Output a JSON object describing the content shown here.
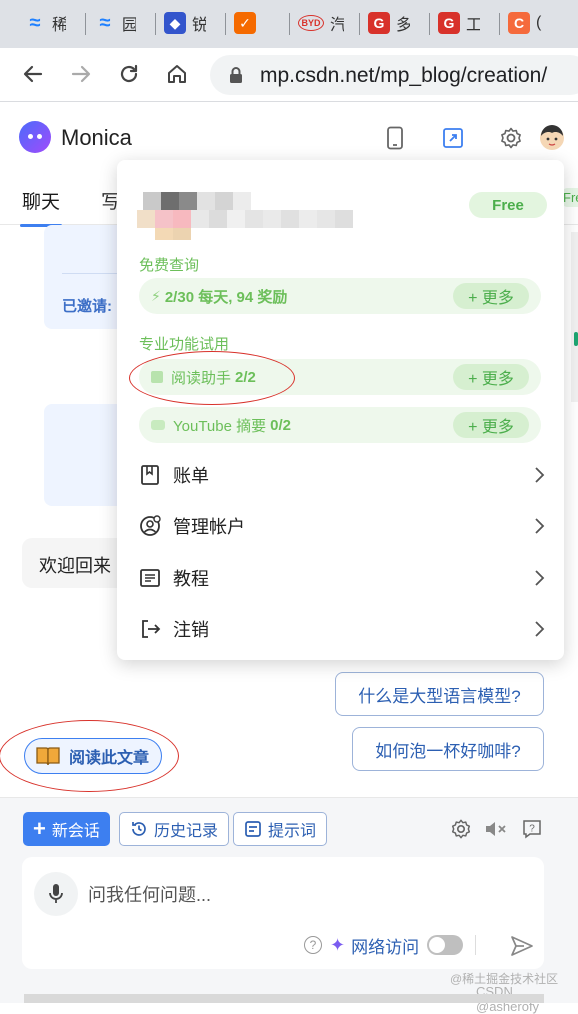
{
  "browser": {
    "tabs": [
      {
        "glyph": "≈",
        "label": "稀",
        "bg": "#ffffff",
        "fg": "#1e80ff"
      },
      {
        "glyph": "≈",
        "label": "园",
        "bg": "#ffffff",
        "fg": "#1e80ff"
      },
      {
        "glyph": "◆",
        "label": "锐",
        "bg": "#3355cc",
        "fg": "#ffffff"
      },
      {
        "glyph": "✓",
        "label": "",
        "bg": "#f56a00",
        "fg": "#ffffff"
      },
      {
        "glyph": "BYD",
        "label": "",
        "bg": "#ffffff",
        "fg": "#d8322b"
      },
      {
        "glyph": "G",
        "label": "多",
        "bg": "#d8322b",
        "fg": "#ffffff"
      },
      {
        "glyph": "G",
        "label": "工",
        "bg": "#d8322b",
        "fg": "#ffffff"
      },
      {
        "glyph": "C",
        "label": "(",
        "bg": "#f56a3c",
        "fg": "#ffffff"
      }
    ],
    "url_host": "mp.csdn.net",
    "url_path": "/mp_blog/creation/"
  },
  "monica": {
    "title": "Monica",
    "tabs": [
      "聊天",
      "写"
    ],
    "invited_label": "已邀请:",
    "welcome": "欢迎回来",
    "edge_free": "Fre",
    "suggestions": [
      "什么是大型语言模型?",
      "如何泡一杯好咖啡?"
    ],
    "read_article": "阅读此文章",
    "toolbar": {
      "new_chat": "新会话",
      "history": "历史记录",
      "prompts": "提示词"
    },
    "input_placeholder": "问我任何问题...",
    "web_access": "网络访问",
    "watermark_line1": "@稀土掘金技术社区",
    "watermark_line2": "CSDN @asherofy"
  },
  "dropdown": {
    "plan_badge": "Free",
    "free_queries_title": "免费查询",
    "free_queries_value": "2/30 每天, 94 奖励",
    "more_label": "+ 更多",
    "pro_title": "专业功能试用",
    "reader_label": "阅读助手",
    "reader_value": "2/2",
    "youtube_label": "YouTube 摘要",
    "youtube_value": "0/2",
    "menu": [
      "账单",
      "管理帐户",
      "教程",
      "注销"
    ]
  },
  "colors": {
    "accent": "#3d7ff0",
    "green": "#6cbf5a",
    "annotation_red": "#d8322b"
  }
}
